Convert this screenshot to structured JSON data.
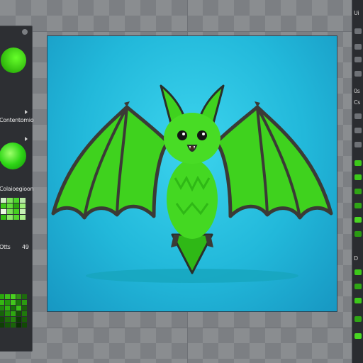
{
  "left_panel": {
    "label_1": "Contentomio",
    "label_2": "Colaioegioon",
    "value_label": "Otts",
    "value": "49"
  },
  "right_panel": {
    "top_text": "Ui",
    "label_1": "0s",
    "label_2": "Cs",
    "label_3": "D"
  },
  "canvas": {
    "subject": "green-bat-illustration"
  },
  "colors": {
    "accent": "#45e51b",
    "canvas_bg": "#22b8da",
    "panel_bg": "#2d2f33"
  }
}
